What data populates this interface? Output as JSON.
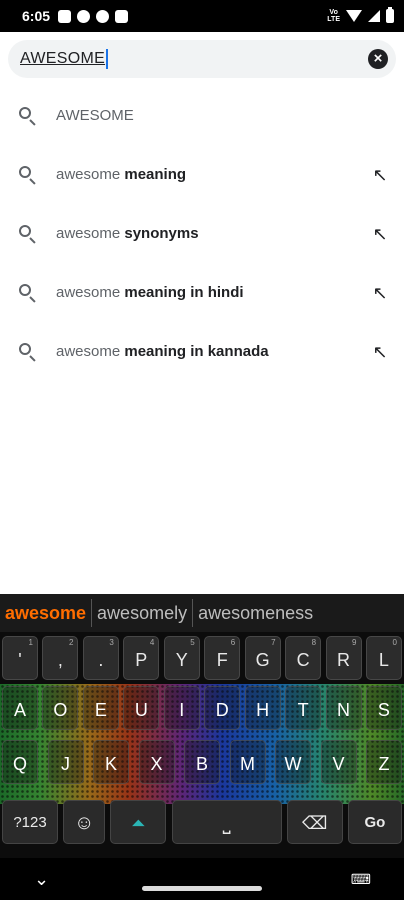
{
  "status_bar": {
    "time": "6:05",
    "volte": "VoLTE"
  },
  "search": {
    "value": "AWESOME"
  },
  "suggestions": [
    {
      "prefix": "AWESOME",
      "suffix": "",
      "has_arrow": false
    },
    {
      "prefix": "awesome ",
      "suffix": "meaning",
      "has_arrow": true
    },
    {
      "prefix": "awesome ",
      "suffix": "synonyms",
      "has_arrow": true
    },
    {
      "prefix": "awesome ",
      "suffix": "meaning in hindi",
      "has_arrow": true
    },
    {
      "prefix": "awesome ",
      "suffix": "meaning in kannada",
      "has_arrow": true
    }
  ],
  "keyboard": {
    "predictions": [
      "awesome",
      "awesomely",
      "awesomeness"
    ],
    "row1": [
      {
        "label": "'",
        "hint": "1"
      },
      {
        "label": ",",
        "hint": "2"
      },
      {
        "label": ".",
        "hint": "3"
      },
      {
        "label": "P",
        "hint": "4"
      },
      {
        "label": "Y",
        "hint": "5"
      },
      {
        "label": "F",
        "hint": "6"
      },
      {
        "label": "G",
        "hint": "7"
      },
      {
        "label": "C",
        "hint": "8"
      },
      {
        "label": "R",
        "hint": "9"
      },
      {
        "label": "L",
        "hint": "0"
      }
    ],
    "row2": [
      "A",
      "O",
      "E",
      "U",
      "I",
      "D",
      "H",
      "T",
      "N",
      "S"
    ],
    "row3": [
      "Q",
      "J",
      "K",
      "X",
      "B",
      "M",
      "W",
      "V",
      "Z"
    ],
    "fn": {
      "sym": "?123",
      "go": "Go"
    }
  },
  "colors": {
    "accent": "#ff6d00",
    "shift": "#2ab5b5"
  }
}
